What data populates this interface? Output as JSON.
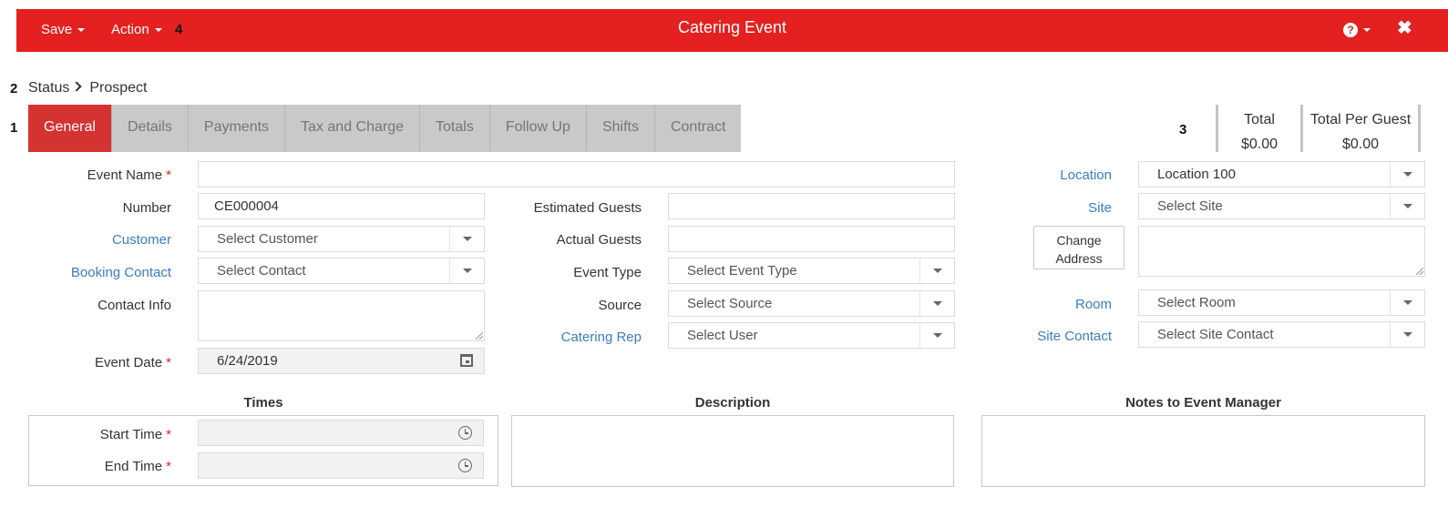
{
  "header": {
    "save_label": "Save",
    "action_label": "Action",
    "marker": "4",
    "title": "Catering Event",
    "help_icon": "question-circle-icon",
    "close_icon": "close-icon",
    "bar_color": "#e52020"
  },
  "markers": {
    "tabs": "1",
    "status": "2",
    "totals": "3"
  },
  "breadcrumb": {
    "root": "Status",
    "current": "Prospect"
  },
  "tabs": [
    {
      "label": "General",
      "active": true
    },
    {
      "label": "Details"
    },
    {
      "label": "Payments"
    },
    {
      "label": "Tax and Charge"
    },
    {
      "label": "Totals"
    },
    {
      "label": "Follow Up"
    },
    {
      "label": "Shifts"
    },
    {
      "label": "Contract"
    }
  ],
  "totals": {
    "total_label": "Total",
    "total_value": "$0.00",
    "per_guest_label": "Total Per Guest",
    "per_guest_value": "$0.00"
  },
  "form": {
    "event_name": {
      "label": "Event Name",
      "value": ""
    },
    "number": {
      "label": "Number",
      "value": "CE000004"
    },
    "customer": {
      "label": "Customer",
      "placeholder": "Select Customer"
    },
    "booking_contact": {
      "label": "Booking Contact",
      "placeholder": "Select Contact"
    },
    "contact_info": {
      "label": "Contact Info",
      "value": ""
    },
    "event_date": {
      "label": "Event Date",
      "value": "6/24/2019"
    },
    "estimated_guests": {
      "label": "Estimated Guests",
      "value": ""
    },
    "actual_guests": {
      "label": "Actual Guests",
      "value": ""
    },
    "event_type": {
      "label": "Event Type",
      "placeholder": "Select Event Type"
    },
    "source": {
      "label": "Source",
      "placeholder": "Select Source"
    },
    "catering_rep": {
      "label": "Catering Rep",
      "placeholder": "Select User"
    },
    "location": {
      "label": "Location",
      "value": "Location 100"
    },
    "site": {
      "label": "Site",
      "placeholder": "Select Site"
    },
    "change_address": {
      "line1": "Change",
      "line2": "Address"
    },
    "room": {
      "label": "Room",
      "placeholder": "Select Room"
    },
    "site_contact": {
      "label": "Site Contact",
      "placeholder": "Select Site Contact"
    },
    "required_mark": "*"
  },
  "times": {
    "heading": "Times",
    "start_label": "Start Time",
    "end_label": "End Time"
  },
  "description": {
    "heading": "Description"
  },
  "notes": {
    "heading": "Notes to Event Manager"
  }
}
